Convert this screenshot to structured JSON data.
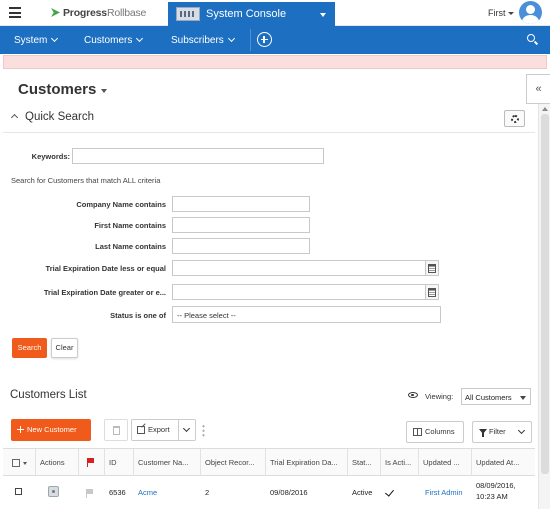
{
  "topbar": {
    "logo_main": "Progress",
    "logo_sub": "Rollbase",
    "app_name": "System Console",
    "user_name": "First"
  },
  "nav": {
    "items": [
      "System",
      "Customers",
      "Subscribers"
    ]
  },
  "page": {
    "title": "Customers",
    "collapse_glyph": "«"
  },
  "quick_search": {
    "title": "Quick Search",
    "keywords_label": "Keywords:",
    "criteria_note": "Search for Customers that match ALL criteria",
    "fields": [
      "Company Name contains",
      "First Name contains",
      "Last Name contains",
      "Trial Expiration Date less or equal",
      "Trial Expiration Date greater or e...",
      "Status is one of"
    ],
    "status_placeholder": "-- Please select --",
    "search_label": "Search",
    "clear_label": "Clear"
  },
  "list": {
    "title": "Customers List",
    "viewing_label": "Viewing:",
    "viewing_value": "All Customers",
    "new_label": "New Customer",
    "export_label": "Export",
    "columns_label": "Columns",
    "filter_label": "Filter",
    "headers": [
      "Actions",
      "ID",
      "Customer Na...",
      "Object Recor...",
      "Trial Expiration Da...",
      "Stat...",
      "Is Acti...",
      "Updated ...",
      "Updated At..."
    ],
    "rows": [
      {
        "id": "6536",
        "customer_name": "Acme",
        "object_records": "2",
        "trial_expiration": "09/08/2016",
        "status": "Active",
        "updated_by": "First Admin",
        "updated_at_date": "08/09/2016,",
        "updated_at_time": "10:23 AM"
      }
    ]
  },
  "colors": {
    "brand_blue": "#1d6fc2",
    "accent_orange": "#f05a1a",
    "alert_pink": "#fbdede"
  }
}
